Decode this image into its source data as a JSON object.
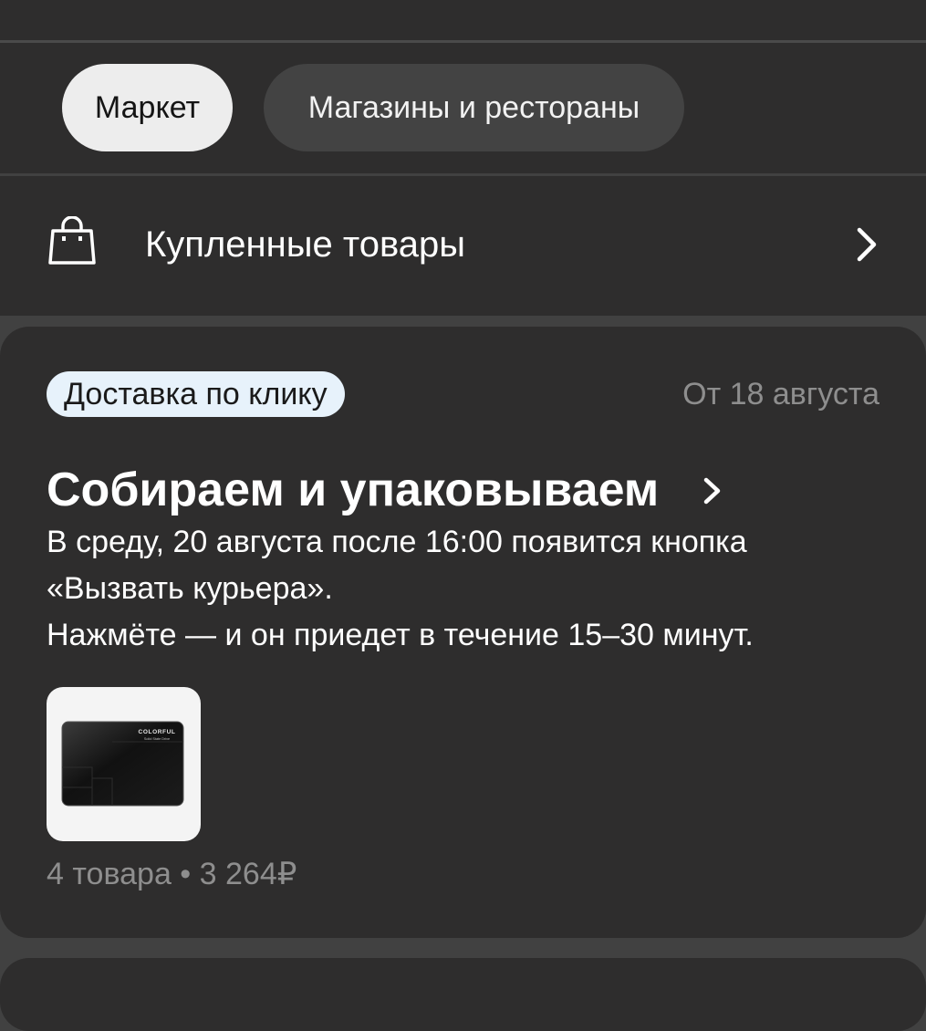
{
  "tabs": [
    {
      "label": "Маркет",
      "active": true
    },
    {
      "label": "Магазины и рестораны",
      "active": false
    }
  ],
  "purchased": {
    "label": "Купленные товары",
    "icon": "shopping-bag-icon"
  },
  "order": {
    "badge": "Доставка по клику",
    "date": "От 18 августа",
    "status_title": "Собираем и упаковываем",
    "description": [
      "В среду, 20 августа после 16:00 появится кнопка",
      "«Вызвать курьера».",
      "Нажмёте — и он приедет в течение 15–30 минут."
    ],
    "product": {
      "brand": "COLORFUL",
      "subtitle": "Solid State Drive"
    },
    "summary": "4 товара • 3 264₽"
  },
  "colors": {
    "background": "#414141",
    "surface": "#2e2d2d",
    "badge_bg": "#e7f2fb",
    "muted_text": "#8e8e8e",
    "active_tab_bg": "#ededed",
    "inactive_tab_bg": "#434343"
  }
}
